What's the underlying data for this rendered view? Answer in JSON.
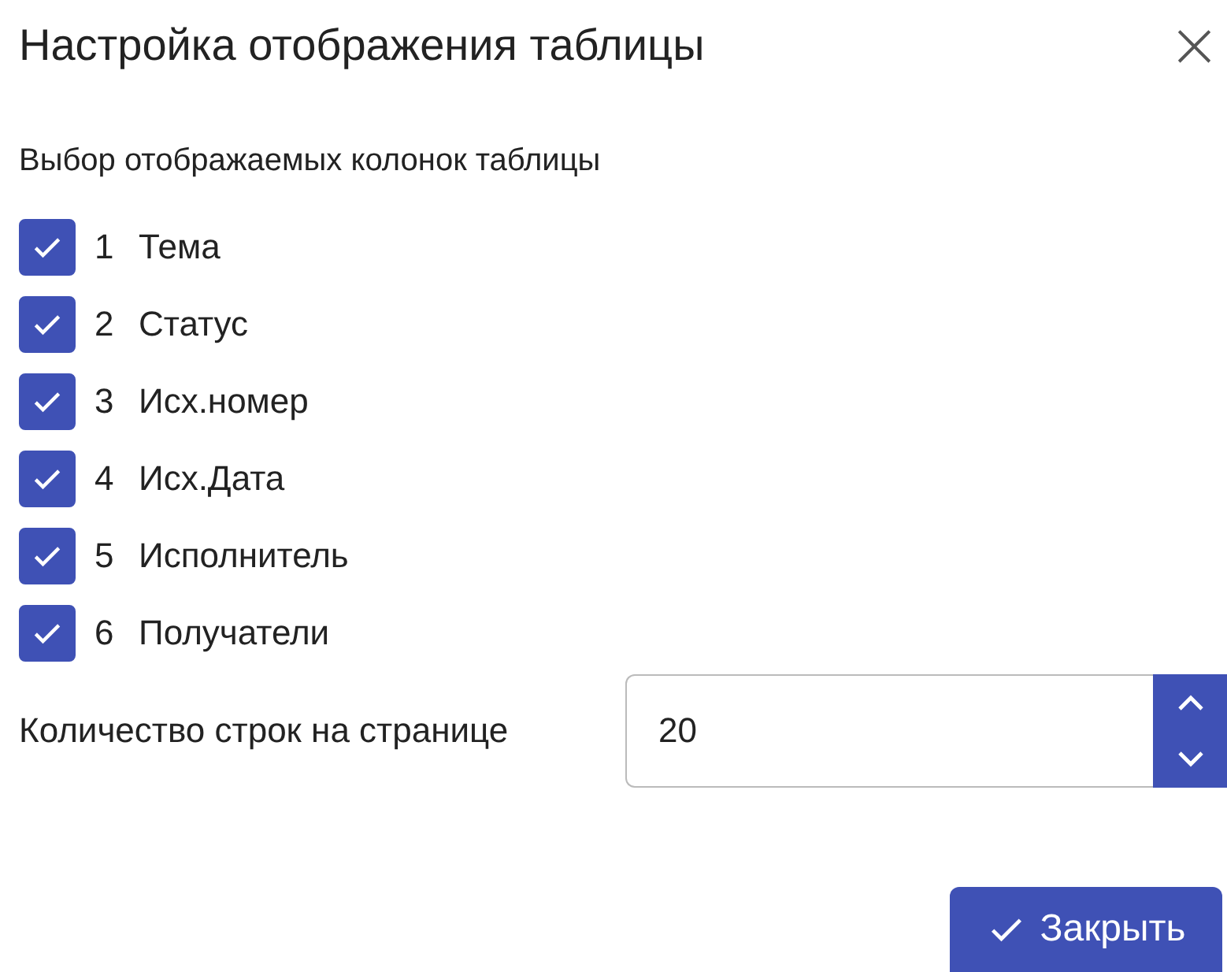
{
  "dialog": {
    "title": "Настройка отображения таблицы",
    "close": "×"
  },
  "section_label": "Выбор отображаемых колонок таблицы",
  "columns": [
    {
      "number": "1",
      "label": "Тема",
      "checked": true
    },
    {
      "number": "2",
      "label": "Статус",
      "checked": true
    },
    {
      "number": "3",
      "label": "Исх.номер",
      "checked": true
    },
    {
      "number": "4",
      "label": "Исх.Дата",
      "checked": true
    },
    {
      "number": "5",
      "label": "Исполнитель",
      "checked": true
    },
    {
      "number": "6",
      "label": "Получатели",
      "checked": true
    }
  ],
  "rows_per_page": {
    "label": "Количество строк на странице",
    "value": "20"
  },
  "buttons": [
    {
      "label": "Закрыть"
    }
  ]
}
